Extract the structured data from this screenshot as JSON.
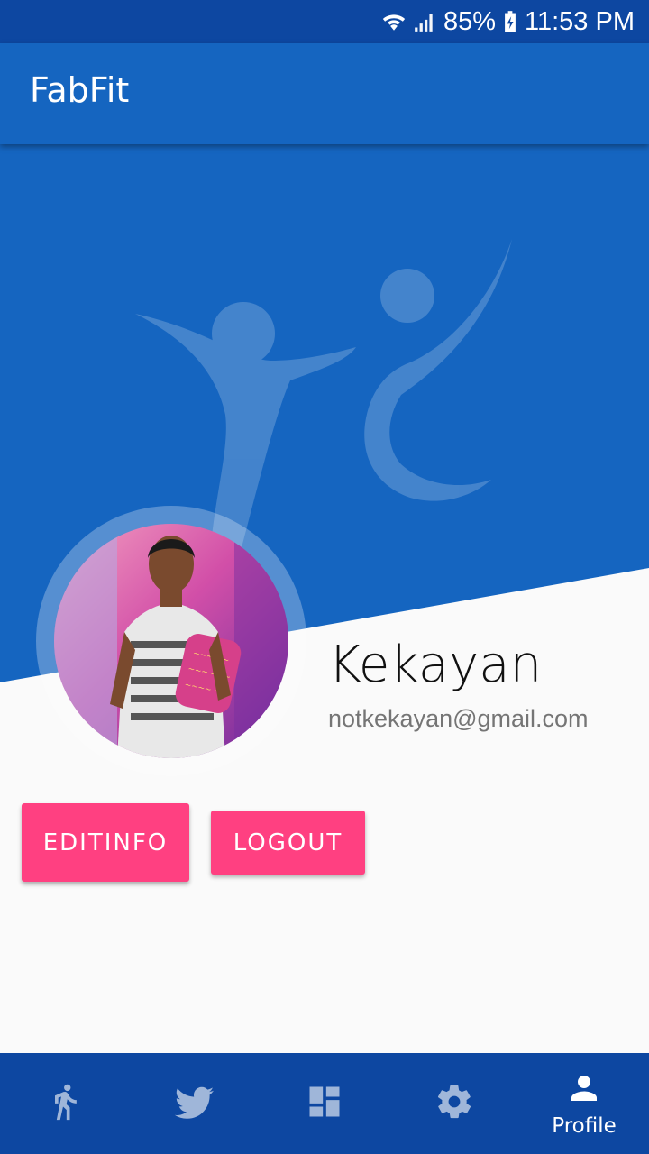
{
  "status_bar": {
    "battery": "85%",
    "time": "11:53 PM",
    "icons": [
      "wifi-icon",
      "cell-signal-icon",
      "battery-charging-icon"
    ]
  },
  "app_bar": {
    "title": "FabFit"
  },
  "profile": {
    "name": "Kekayan",
    "email": "notkekayan@gmail.com"
  },
  "actions": {
    "edit_label": "EDITINFO",
    "logout_label": "LOGOUT"
  },
  "bottom_nav": {
    "items": [
      {
        "icon": "walk-icon",
        "label": ""
      },
      {
        "icon": "twitter-icon",
        "label": ""
      },
      {
        "icon": "dashboard-icon",
        "label": ""
      },
      {
        "icon": "gear-icon",
        "label": ""
      },
      {
        "icon": "person-icon",
        "label": "Profile",
        "active": true
      }
    ]
  },
  "colors": {
    "status_bar": "#0d47a1",
    "primary": "#1565c0",
    "accent": "#ff4081",
    "background": "#fafafa"
  }
}
